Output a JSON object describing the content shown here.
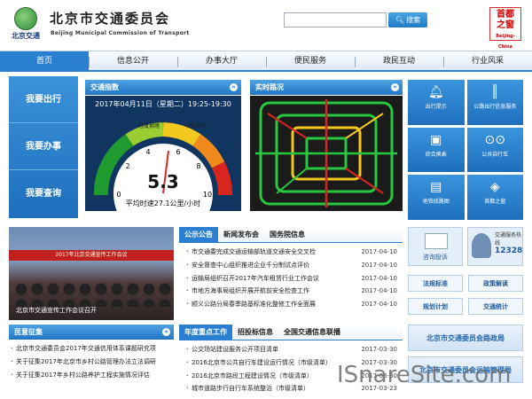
{
  "header": {
    "logo_text": "北京交通",
    "title": "北京市交通委员会",
    "subtitle": "Beijing Municipal Commission of Transport",
    "search_placeholder": "",
    "search_button": "搜索",
    "stamp_line1": "首都",
    "stamp_line2": "之窗",
    "stamp_en": "Beijing-China"
  },
  "nav": [
    "首页",
    "信息公开",
    "办事大厅",
    "便民服务",
    "政民互动",
    "行业风采"
  ],
  "leftnav": [
    "我要出行",
    "我要办事",
    "我要查询"
  ],
  "traffic_index": {
    "title": "交通指数",
    "date": "2017年04月11日（星期二）19:25-19:30",
    "levels": [
      "畅通",
      "基本畅通",
      "轻度拥堵",
      "中度拥堵",
      "严重拥堵"
    ],
    "value": "5.3",
    "speed": "平均时速27.1公里/小时",
    "ticks": [
      "0",
      "2",
      "4",
      "6",
      "8",
      "10"
    ]
  },
  "traffic_map": {
    "title": "实时路况"
  },
  "tiles": [
    {
      "label": "出行提示",
      "icon": "bell-icon"
    },
    {
      "label": "公路出行信息服务",
      "icon": "road-icon"
    },
    {
      "label": "综合换乘",
      "icon": "bus-icon"
    },
    {
      "label": "公共自行车",
      "icon": "bike-icon"
    },
    {
      "label": "地铁线路图",
      "icon": "metro-icon"
    },
    {
      "label": "首都之窗",
      "icon": "window-icon"
    }
  ],
  "photo": {
    "banner": "2017年北京交通宣传工作会议",
    "caption": "北京市交通宣传工作会议召开"
  },
  "announce": {
    "tabs": [
      "公示公告",
      "新闻发布会",
      "国务院信息"
    ],
    "rows": [
      {
        "t": "市交通委完成交通运输部轨道交通安全交叉检",
        "d": "2017-04-10"
      },
      {
        "t": "安全督查中心组织推进企业千分制试点评价",
        "d": "2017-04-10"
      },
      {
        "t": "运输局组织召开2017年汽车租赁行业工作会议",
        "d": "2017-04-10"
      },
      {
        "t": "市地方海事局组织开展开航前安全检查工作",
        "d": "2017-04-10"
      },
      {
        "t": "顺义公路分局春季路基标准化整修工作全面展",
        "d": "2017-04-10"
      }
    ]
  },
  "service": {
    "consult": "咨询投诉",
    "hotline": "交通服务热线",
    "number": "12328"
  },
  "btns": [
    "法规标准",
    "政策解读",
    "规划计划",
    "交通统计"
  ],
  "links": [
    "北京市交通委员会路政局",
    "北京市交通委员会运输管理局"
  ],
  "solicit": {
    "title": "民意征集",
    "rows": [
      "北京市交通委员会2017年交通信用体系课题研究项",
      "关于征集2017年北京市乡村公路管理办法立法调研",
      "关于征集2017年乡村公路养护工程实施情况评估"
    ]
  },
  "focus": {
    "tabs": [
      "年度重点工作",
      "招投标信息",
      "全国交通信息联播"
    ],
    "rows": [
      {
        "t": "公交场站建设服务公开项目清单",
        "d": "2017-03-30"
      },
      {
        "t": "2016北京市公共自行车建设运行情况（市级清单）",
        "d": "2017-03-30"
      },
      {
        "t": "2016北京市路段工程建设情况（市级清单）",
        "d": "2017-03-30"
      },
      {
        "t": "城市道路步行自行车系统整治（市级清单）",
        "d": "2017-03-23"
      }
    ]
  },
  "watermark": "ISnareSite.com",
  "colors": {
    "accent": "#2a7fd0",
    "gauge_bg": "#0f3560"
  }
}
